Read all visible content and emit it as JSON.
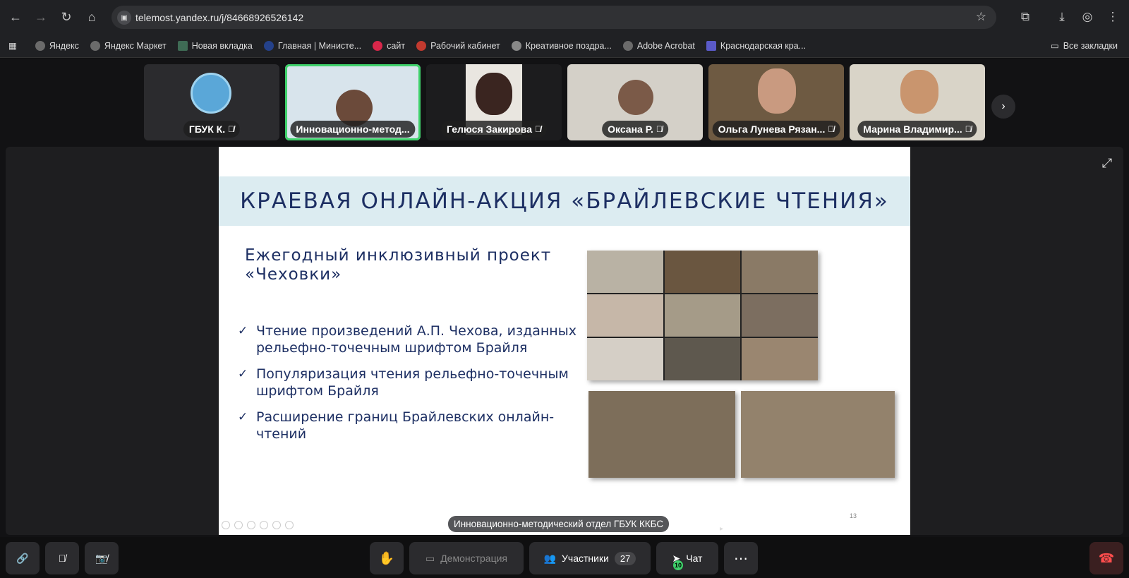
{
  "browser": {
    "url": "telemost.yandex.ru/j/84668926526142",
    "bookmarks": [
      {
        "label": "Яндекс"
      },
      {
        "label": "Яндекс Маркет"
      },
      {
        "label": "Новая вкладка"
      },
      {
        "label": "Главная | Министе..."
      },
      {
        "label": "сайт"
      },
      {
        "label": "Рабочий кабинет"
      },
      {
        "label": "Креативное поздра..."
      },
      {
        "label": "Adobe Acrobat"
      },
      {
        "label": "Краснодарская кра..."
      }
    ],
    "all_bookmarks": "Все закладки"
  },
  "participants": [
    {
      "name": "ГБУК К.",
      "active": false
    },
    {
      "name": "Инновационно-метод...",
      "active": true
    },
    {
      "name": "Гелюся Закирова",
      "active": false
    },
    {
      "name": "Оксана Р.",
      "active": false
    },
    {
      "name": "Ольга Лунева Рязан...",
      "active": false
    },
    {
      "name": "Марина Владимир...",
      "active": false
    }
  ],
  "slide": {
    "title": "КРАЕВАЯ ОНЛАЙН-АКЦИЯ «БРАЙЛЕВСКИЕ ЧТЕНИЯ»",
    "subtitle": "Ежегодный инклюзивный проект «Чеховки»",
    "bullets": [
      "Чтение произведений А.П. Чехова, изданных рельефно-точечным шрифтом Брайля",
      "Популяризация чтения рельефно-точечным шрифтом Брайля",
      "Расширение границ Брайлевских онлайн-чтений"
    ],
    "page_number": "13"
  },
  "presenter_caption": "Инновационно-методический отдел ГБУК ККБС",
  "controls": {
    "demo_label": "Демонстрация",
    "participants_label": "Участники",
    "participants_count": "27",
    "chat_label": "Чат",
    "chat_badge": "10"
  },
  "colors": {
    "active_outline": "#3fd26b",
    "slide_text": "#1d2f63",
    "slide_band": "#dcecf1",
    "end_call": "#ff4d4d"
  }
}
